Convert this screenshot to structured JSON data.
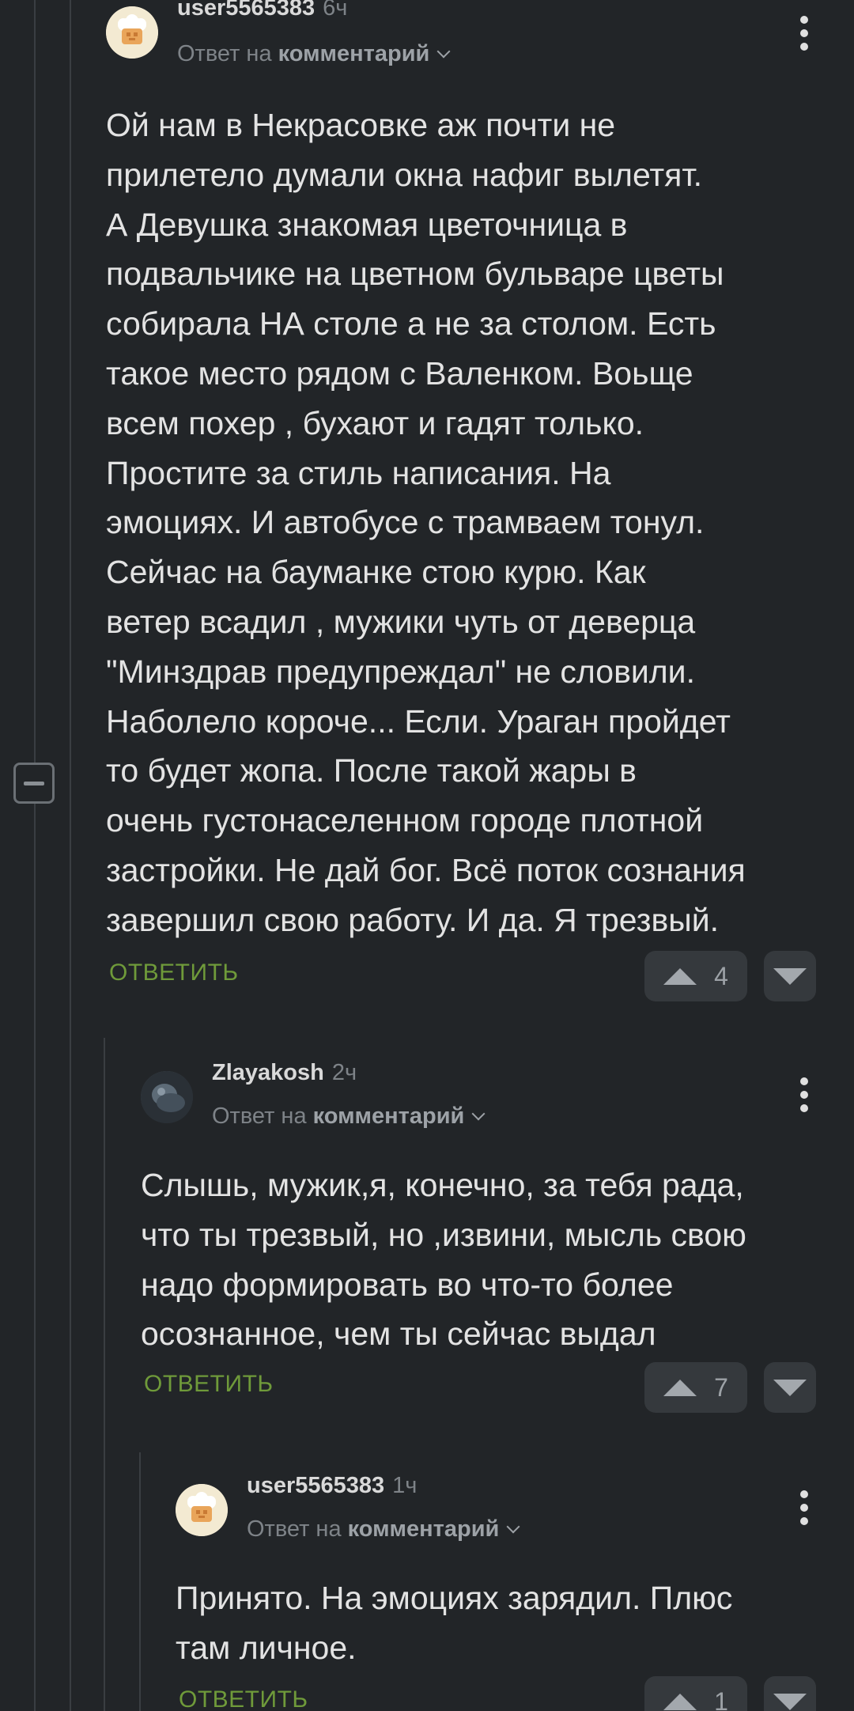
{
  "comments": [
    {
      "username": "user5565383",
      "time": "6ч",
      "reply_prefix": "Ответ на",
      "reply_link": "комментарий",
      "avatar_icon": "chef-hat-avatar",
      "body": "Ой нам в Некрасовке аж почти не\nприлетело думали окна нафиг вылетят.\nА Девушка знакомая цветочница в\nподвальчике на цветном бульваре цветы\nсобирала НА столе а не за столом. Есть\nтакое место рядом с Валенком. Воьще\nвсем похер , бухают и гадят только.\nПростите за стиль написания. На\nэмоциях. И автобусе с трамваем тонул.\nСейчас на бауманке стою курю. Как\nветер всадил , мужики чуть от деверца\n\"Минздрав предупреждал\" не словили.\nНаболело короче... Если. Ураган пройдет\nто будет жопа. После такой жары в\nочень густонаселенном городе плотной\nзастройки. Не дай бог. Всё поток сознания\nзавершил свою работу. И да. Я трезвый.",
      "reply_label": "ОТВЕТИТЬ",
      "votes": "4"
    },
    {
      "username": "Zlayakosh",
      "time": "2ч",
      "reply_prefix": "Ответ на",
      "reply_link": "комментарий",
      "avatar_icon": "dark-avatar",
      "body": "Слышь, мужик,я, конечно, за тебя рада,\nчто ты трезвый, но ,извини, мысль свою\nнадо формировать во что-то более\nосознанное, чем ты сейчас выдал",
      "reply_label": "ОТВЕТИТЬ",
      "votes": "7"
    },
    {
      "username": "user5565383",
      "time": "1ч",
      "reply_prefix": "Ответ на",
      "reply_link": "комментарий",
      "avatar_icon": "chef-hat-avatar",
      "body": "Принято. На эмоциях зарядил. Плюс\nтам личное.",
      "reply_label": "ОТВЕТИТЬ",
      "votes": "1"
    }
  ],
  "collapse_icon": "minus-icon",
  "colors": {
    "background": "#222528",
    "reply_green": "#6f9a3a",
    "vote_bg": "#35393d"
  }
}
